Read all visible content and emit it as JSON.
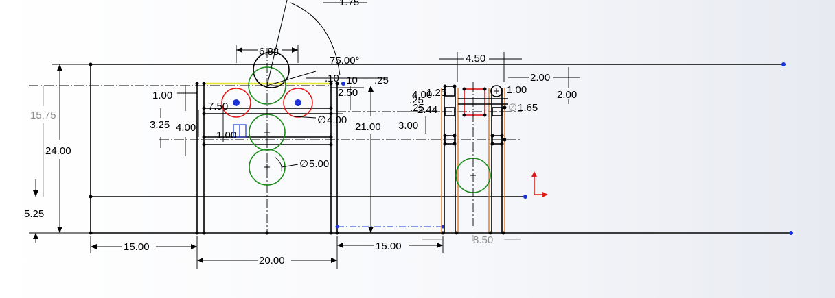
{
  "dimensions": {
    "left_width": "15.00",
    "middle_width": "20.00",
    "right_width": "15.00",
    "right_detail_width": "8.50",
    "total_height": "24.00",
    "lower_height": "5.25",
    "upper_height": "15.75",
    "offset_1": "1.00",
    "offset_2": "3.25",
    "offset_3": "4.00",
    "roller_spacing": "6.88",
    "small_offset": "7.50",
    "block_width": "1.00",
    "angle": "75.00°",
    "gap_1": ".10",
    "gap_2": ".25",
    "gap_3": "2.50",
    "clear_height": "21.00",
    "hole_small": "4.00",
    "hole_large": "5.00",
    "top_partial": "1.75",
    "column_width": "4.50",
    "col_offset_a": "2.00",
    "col_offset_b": "2.00",
    "col_step": "1.00",
    "pin_dia": "1.65",
    "col_height": "3.00",
    "col_depth": "2.44",
    "crowd_a": "4.00",
    "crowd_b": "1.25",
    "crowd_c": ".25",
    "crowd_d": ".25",
    "dia_prefix": "∅"
  },
  "colors": {
    "geometry": "#000000",
    "construction_green": "#1a8a1a",
    "highlight_red": "#e01818",
    "selected_orange": "#e07a20",
    "point_blue": "#1a33d6",
    "edge_yellow": "#e5e534",
    "driven_grey": "#8d8d8d"
  },
  "icons": {
    "origin": "origin-triad-icon"
  }
}
